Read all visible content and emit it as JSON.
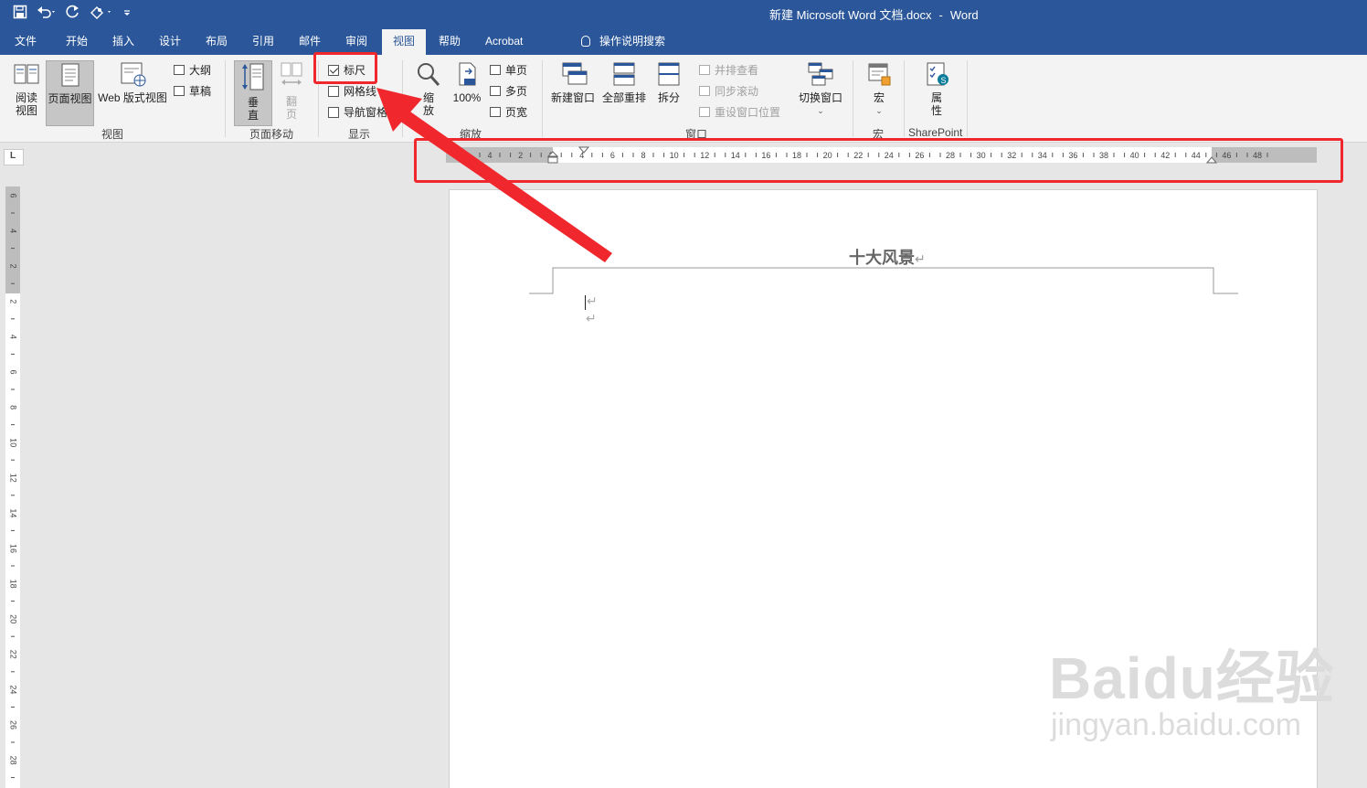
{
  "window": {
    "doc_name": "新建 Microsoft Word 文档.docx",
    "separator": "-",
    "app_name": "Word"
  },
  "qat": {
    "save_icon": "save-icon",
    "undo_icon": "undo-icon",
    "redo_icon": "redo-icon",
    "touch_icon": "touch-mode-icon"
  },
  "tabs": [
    {
      "label": "文件"
    },
    {
      "label": "开始"
    },
    {
      "label": "插入"
    },
    {
      "label": "设计"
    },
    {
      "label": "布局"
    },
    {
      "label": "引用"
    },
    {
      "label": "邮件"
    },
    {
      "label": "审阅"
    },
    {
      "label": "视图",
      "active": true
    },
    {
      "label": "帮助"
    },
    {
      "label": "Acrobat"
    }
  ],
  "tell_me": {
    "label": "操作说明搜索"
  },
  "ribbon": {
    "views": {
      "read_mode_1": "阅读",
      "read_mode_2": "视图",
      "print_layout": "页面视图",
      "web_layout": "Web 版式视图",
      "outline": "大纲",
      "draft": "草稿",
      "label": "视图"
    },
    "page_movement": {
      "vertical_1": "垂",
      "vertical_2": "直",
      "side_1": "翻",
      "side_2": "页",
      "label": "页面移动"
    },
    "show": {
      "ruler": "标尺",
      "ruler_checked": true,
      "gridlines": "网格线",
      "gridlines_checked": false,
      "nav_pane": "导航窗格",
      "nav_pane_checked": false,
      "label": "显示"
    },
    "zoom": {
      "zoom_1": "缩",
      "zoom_2": "放",
      "hundred": "100%",
      "one_page": "单页",
      "multi_page": "多页",
      "page_width": "页宽",
      "label": "缩放"
    },
    "window": {
      "new_window": "新建窗口",
      "arrange_all": "全部重排",
      "split": "拆分",
      "side_by_side": "并排查看",
      "sync_scroll": "同步滚动",
      "reset_position": "重设窗口位置",
      "switch_windows": "切换窗口",
      "label": "窗口"
    },
    "macros": {
      "macros": "宏",
      "label": "宏"
    },
    "sharepoint": {
      "properties_1": "属",
      "properties_2": "性",
      "label": "SharePoint"
    }
  },
  "rulers": {
    "horizontal_labels": [
      "4",
      "2",
      "2",
      "4",
      "6",
      "8",
      "10",
      "12",
      "14",
      "16",
      "18",
      "20",
      "22",
      "24",
      "26",
      "28",
      "30",
      "32",
      "34",
      "36",
      "38",
      "40",
      "42",
      "44",
      "46",
      "48"
    ],
    "vertical_labels": [
      "6",
      "4",
      "2",
      "2",
      "4",
      "6",
      "8",
      "10",
      "12",
      "14",
      "16",
      "18",
      "20",
      "22",
      "24",
      "26",
      "28"
    ]
  },
  "document": {
    "title": "十大风景",
    "para_mark": "↵"
  },
  "watermark": {
    "main": "Baidu经验",
    "sub": "jingyan.baidu.com"
  },
  "annotation": {
    "color": "#f0282d"
  }
}
